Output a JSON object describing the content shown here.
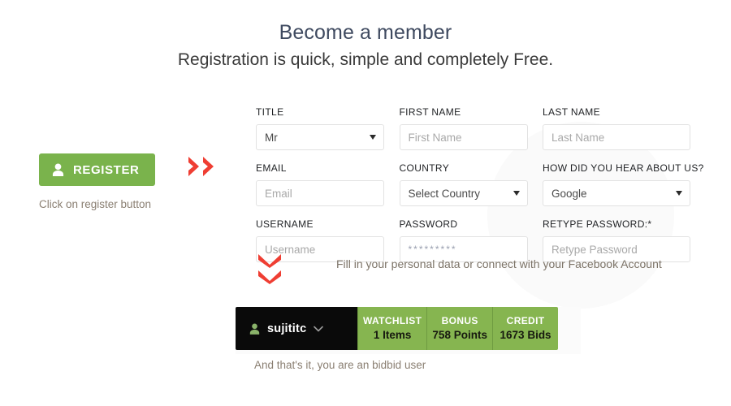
{
  "header": {
    "title": "Become a member",
    "subtitle": "Registration is quick, simple and completely Free."
  },
  "steps": {
    "register": {
      "button_label": "REGISTER",
      "button_icon": "person-icon",
      "caption": "Click on register button",
      "arrow_icon": "double-chevron-right-icon"
    },
    "fill_form": {
      "caption": "Fill in your personal data or connect with your Facebook Account",
      "arrow_icon": "double-chevron-down-icon"
    },
    "done": {
      "caption": "And that's it, you are an bidbid user"
    }
  },
  "form": {
    "fields": [
      {
        "label": "TITLE",
        "type": "select",
        "value": "Mr",
        "placeholder": ""
      },
      {
        "label": "FIRST NAME",
        "type": "text",
        "value": "",
        "placeholder": "First Name"
      },
      {
        "label": "LAST NAME",
        "type": "text",
        "value": "",
        "placeholder": "Last Name"
      },
      {
        "label": "EMAIL",
        "type": "text",
        "value": "",
        "placeholder": "Email"
      },
      {
        "label": "COUNTRY",
        "type": "select",
        "value": "Select Country",
        "placeholder": ""
      },
      {
        "label": "HOW DID YOU HEAR ABOUT US?",
        "type": "select",
        "value": "Google",
        "placeholder": ""
      },
      {
        "label": "USERNAME",
        "type": "text",
        "value": "",
        "placeholder": "Username"
      },
      {
        "label": "PASSWORD",
        "type": "password",
        "value": "*********",
        "placeholder": ""
      },
      {
        "label": "RETYPE PASSWORD:*",
        "type": "text",
        "value": "",
        "placeholder": "Retype Password"
      }
    ]
  },
  "userbar": {
    "username": "sujititc",
    "account_icon": "person-icon",
    "dropdown_icon": "chevron-down-icon",
    "stats": [
      {
        "label": "WATCHLIST",
        "value": "1 Items"
      },
      {
        "label": "BONUS",
        "value": "758 Points"
      },
      {
        "label": "CREDIT",
        "value": "1673 Bids"
      }
    ]
  },
  "colors": {
    "green": "#7ab34c",
    "green_bar": "#86b550",
    "red_arrow": "#ef3e33",
    "title_blue": "#3f4a60",
    "caption_brown": "#8a7f72",
    "black_bar": "#0a0a0a"
  }
}
